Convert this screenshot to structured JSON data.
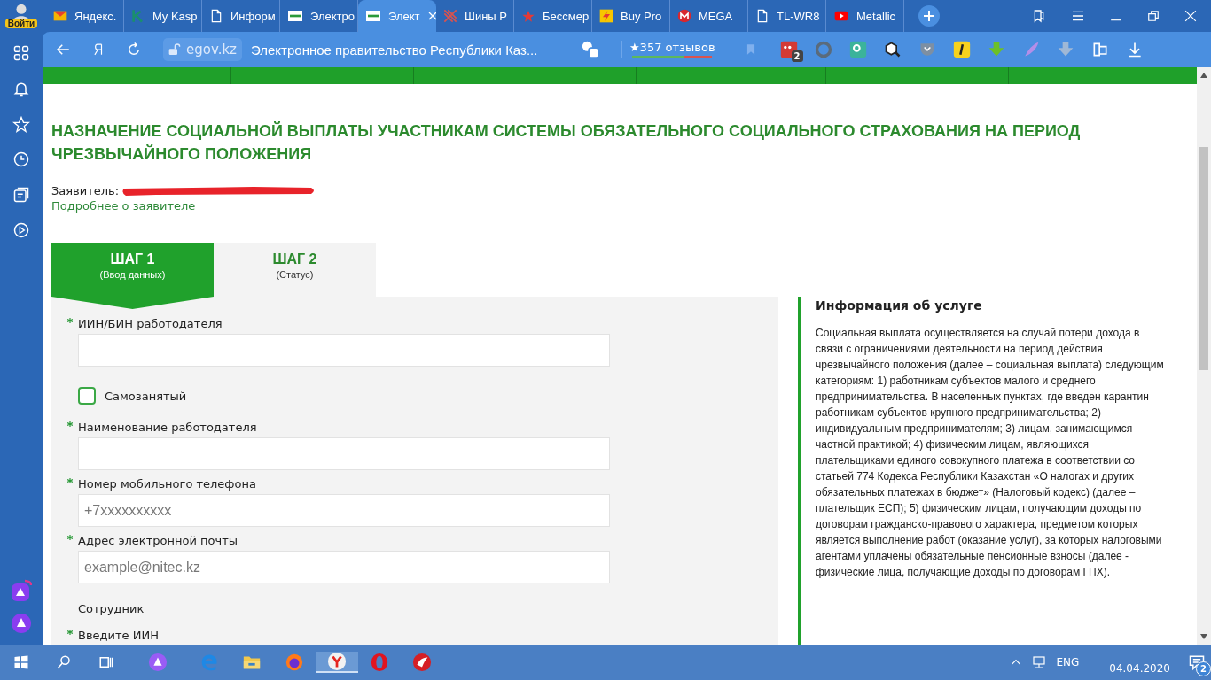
{
  "sidebar": {
    "login_label": "Войти"
  },
  "tabs": [
    {
      "title": "Яндекс.",
      "selected": false
    },
    {
      "title": "My Kasp",
      "selected": false
    },
    {
      "title": "Информ",
      "selected": false
    },
    {
      "title": "Электро",
      "selected": false
    },
    {
      "title": "Элект",
      "selected": true
    },
    {
      "title": "Шины Р",
      "selected": false
    },
    {
      "title": "Бессмер",
      "selected": false
    },
    {
      "title": "Buy Pro",
      "selected": false
    },
    {
      "title": "MEGA",
      "selected": false
    },
    {
      "title": "TL-WR8",
      "selected": false
    },
    {
      "title": "Metallic",
      "selected": false
    }
  ],
  "address_bar": {
    "domain": "egov.kz",
    "page_title": "Электронное правительство Республики Каз...",
    "reviews": "★357 отзывов",
    "extension_badge": "2"
  },
  "page": {
    "title": "НАЗНАЧЕНИЕ СОЦИАЛЬНОЙ ВЫПЛАТЫ УЧАСТНИКАМ СИСТЕМЫ ОБЯЗАТЕЛЬНОГО СОЦИАЛЬНОГО СТРАХОВАНИЯ НА ПЕРИОД ЧРЕЗВЫЧАЙНОГО ПОЛОЖЕНИЯ",
    "applicant_label": "Заявитель:",
    "applicant_link": "Подробнее о заявителе",
    "steps": [
      {
        "title": "ШАГ 1",
        "subtitle": "(Ввод данных)",
        "selected": true
      },
      {
        "title": "ШАГ 2",
        "subtitle": "(Статус)",
        "selected": false
      }
    ],
    "fields": [
      {
        "kind": "input",
        "label": "ИИН/БИН работодателя",
        "required": true
      },
      {
        "kind": "checkbox",
        "label": "Самозанятый",
        "checked": false
      },
      {
        "kind": "input",
        "label": "Наименование работодателя",
        "required": true
      },
      {
        "kind": "input",
        "label": "Номер мобильного телефона",
        "required": true,
        "placeholder": "+7xxxxxxxxxx"
      },
      {
        "kind": "input",
        "label": "Адрес электронной почты",
        "required": true,
        "placeholder": "example@nitec.kz"
      },
      {
        "kind": "heading",
        "label": "Сотрудник"
      },
      {
        "kind": "label",
        "label": "Введите ИИН",
        "required": true
      }
    ],
    "info": {
      "title": "Информация об услуге",
      "text": "Социальная выплата осуществляется на случай потери дохода в связи с ограничениями деятельности на период действия чрезвычайного положения (далее – социальная выплата) следующим категориям: 1) работникам субъектов малого и среднего предпринимательства. В населенных пунктах, где введен карантин работникам субъектов крупного предпринимательства; 2) индивидуальным предпринимателям; 3) лицам, занимающимся частной практикой; 4) физическим лицам, являющихся плательщиками единого совокупного платежа в соответствии со статьей 774 Кодекса Республики Казахстан «О налогах и других обязательных платежах в бюджет» (Налоговый кодекс) (далее – плательщик ЕСП); 5) физическим лицам, получающим доходы по договорам гражданско-правового характера, предметом которых является выполнение работ (оказание услуг), за которых налоговыми агентами уплачены обязательные пенсионные взносы (далее - физические лица, получающие доходы по договорам ГПХ)."
    }
  },
  "taskbar": {
    "language": "ENG",
    "date": "04.04.2020",
    "notification_count": "2"
  }
}
